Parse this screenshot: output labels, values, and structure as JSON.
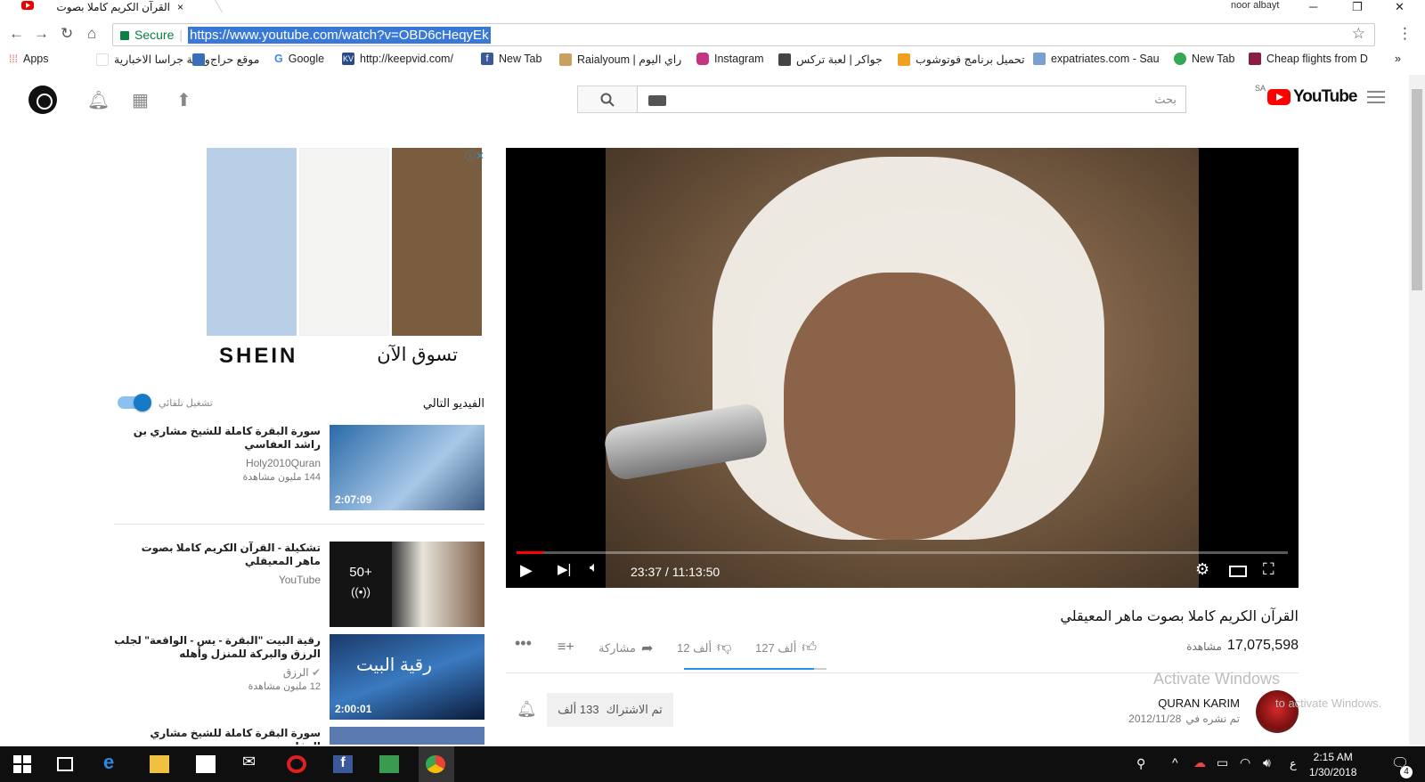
{
  "browser": {
    "tab_title": "القرآن الكريم كاملا بصوت",
    "tab_close": "×",
    "user": "noor albayt",
    "url": "https://www.youtube.com/watch?v=OBD6cHeqyEk",
    "secure_label": "Secure"
  },
  "bookmarks": [
    {
      "label": "Apps",
      "color": "#e04848"
    },
    {
      "label": "وكالة جراسا الاخبارية",
      "color": "#ffffff"
    },
    {
      "label": "موقع حراج",
      "color": "#3a6fb8"
    },
    {
      "label": "Google",
      "color": "#4285f4"
    },
    {
      "label": "http://keepvid.com/",
      "color": "#2a4a8a"
    },
    {
      "label": "New Tab",
      "color": "#3b5998"
    },
    {
      "label": "Raialyoum | راي اليوم",
      "color": "#c8a060"
    },
    {
      "label": "Instagram",
      "color": "#c13584"
    },
    {
      "label": "جواكر | لعبة تركس",
      "color": "#444444"
    },
    {
      "label": "تحميل برنامج فوتوشوب",
      "color": "#f0a020"
    },
    {
      "label": "expatriates.com - Sau",
      "color": "#7aa0d0"
    },
    {
      "label": "New Tab",
      "color": "#34a853"
    },
    {
      "label": "Cheap flights from D",
      "color": "#8a1e3e"
    }
  ],
  "bookmarks_more": "»",
  "masthead": {
    "search_placeholder": "بحث",
    "logo_text": "YouTube",
    "region": "SA"
  },
  "ad": {
    "brand": "SHEIN",
    "cta": "تسوق الآن",
    "choice": "ⓘ✕",
    "colors": [
      "#b9cfe8",
      "#f4f4f2",
      "#7a5c3e"
    ]
  },
  "player": {
    "time": "23:37 / 11:13:50",
    "progress_fraction": 0.035
  },
  "video": {
    "title": "القرآن الكريم كاملا بصوت ماهر المعيقلي",
    "views": "17,075,598",
    "views_label": "مشاهدة",
    "likes": "127 ألف",
    "dislikes": "12 ألف",
    "share": "مشاركة",
    "like_ratio": 0.91
  },
  "channel": {
    "name": "QURAN KARIM",
    "publish_label": "تم نشره في",
    "publish_date": "2012/11/28",
    "subscribe_label": "تم الاشتراك",
    "subscribe_count": "133 ألف"
  },
  "activate": {
    "line1": "Activate Windows",
    "line2": "to activate Windows."
  },
  "upnext": {
    "label": "الفيديو التالي",
    "autoplay": "تشغيل تلقائي",
    "items": [
      {
        "title": "سورة البقرة كاملة للشيخ مشاري بن راشد العفاسي",
        "channel": "Holy2010Quran",
        "views": "144 مليون مشاهدة",
        "duration": "2:07:09"
      },
      {
        "title": "تشكيلة - القرآن الكريم كاملا بصوت ماهر المعيقلي",
        "channel": "YouTube",
        "views": "",
        "duration": "",
        "playlist": "50+"
      },
      {
        "title": "رقية البيت \"البقرة - يس - الواقعة\" لجلب الرزق والبركة للمنزل وأهله",
        "channel": "الرزق",
        "views": "12 مليون مشاهدة",
        "duration": "2:00:01",
        "thumb_text": "رقية البيت"
      },
      {
        "title": "سورة البقرة كاملة للشيخ مشاري العفاسي",
        "channel": "",
        "views": "",
        "duration": ""
      }
    ]
  },
  "taskbar": {
    "time": "2:15 AM",
    "date": "1/30/2018",
    "lang": "ع",
    "notif_count": "4"
  }
}
